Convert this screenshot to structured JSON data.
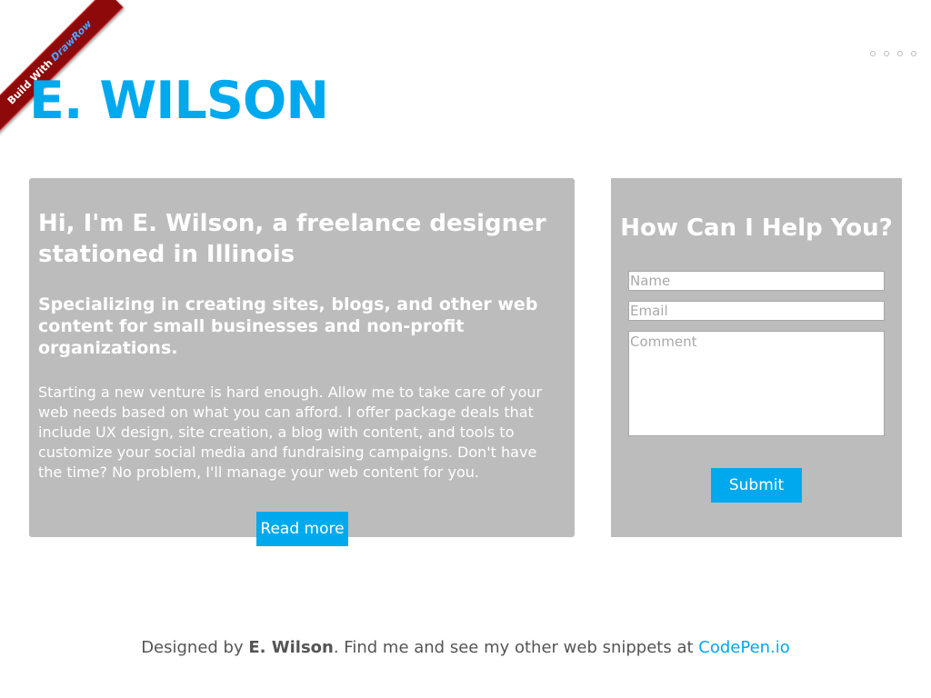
{
  "ribbon": {
    "prefix": "Build With",
    "brand": "DrawRow"
  },
  "header": {
    "title": "E. WILSON"
  },
  "intro": {
    "heading": "Hi, I'm E. Wilson, a freelance designer stationed in Illinois",
    "subheading": "Specializing in creating sites, blogs, and other web content for small businesses and non-profit organizations.",
    "body": "Starting a new venture is hard enough. Allow me to take care of your web needs based on what you can afford. I offer package deals that include UX design, site creation, a blog with content, and tools to customize your social media and fundraising campaigns. Don't have the time? No problem, I'll manage your web content for you.",
    "read_more_label": "Read more"
  },
  "contact": {
    "heading": "How Can I Help You?",
    "name_placeholder": "Name",
    "email_placeholder": "Email",
    "comment_placeholder": "Comment",
    "submit_label": "Submit"
  },
  "footer": {
    "prefix": "Designed by ",
    "author": "E. Wilson",
    "middle": ". Find me and see my other web snippets at ",
    "link_text": "CodePen.io"
  },
  "colors": {
    "accent": "#00a9ee",
    "panel": "#bcbcbc",
    "ribbon": "#8e0a0a"
  }
}
